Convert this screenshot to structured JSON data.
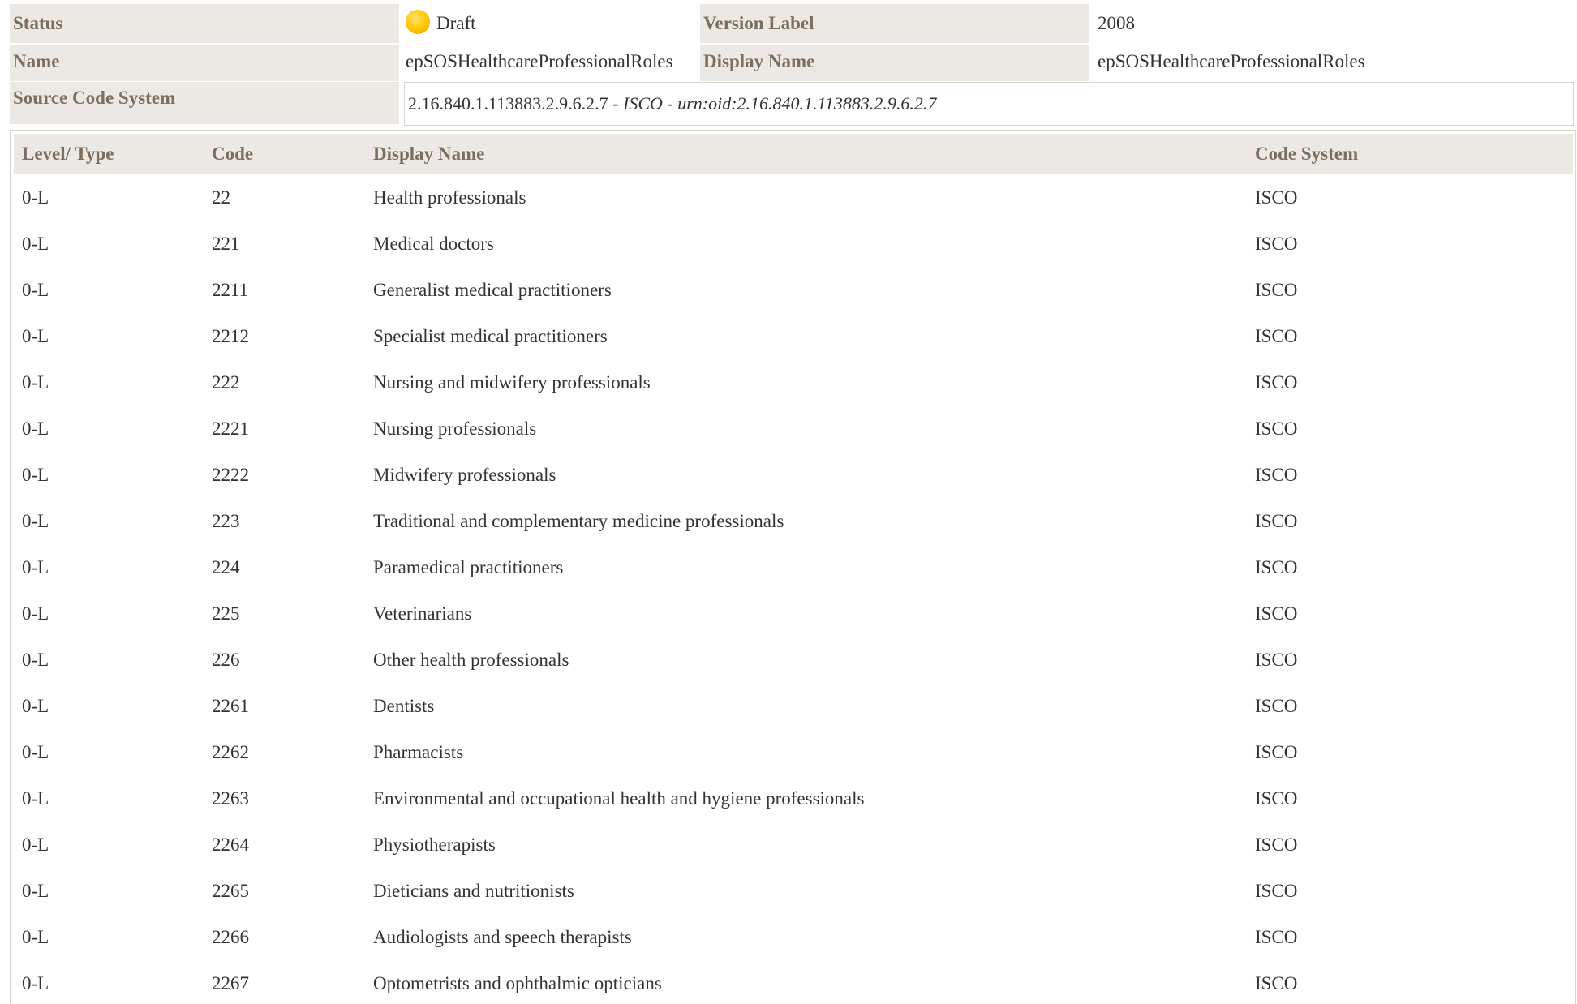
{
  "meta": {
    "status_label": "Status",
    "status_value": "Draft",
    "status_color": "#ffc400",
    "version_label": "Version Label",
    "version_value": "2008",
    "name_label": "Name",
    "name_value": "epSOSHealthcareProfessionalRoles",
    "display_name_label": "Display Name",
    "display_name_value": "epSOSHealthcareProfessionalRoles",
    "source_label": "Source Code System",
    "source_oid": "2.16.840.1.113883.2.9.6.2.7",
    "source_sep1": " - ",
    "source_name": "ISCO",
    "source_sep2": " - ",
    "source_urn": "urn:oid:2.16.840.1.113883.2.9.6.2.7"
  },
  "table": {
    "headers": [
      "Level/ Type",
      "Code",
      "Display Name",
      "Code System"
    ],
    "rows": [
      [
        "0-L",
        "22",
        "Health professionals",
        "ISCO"
      ],
      [
        "0-L",
        "221",
        "Medical doctors",
        "ISCO"
      ],
      [
        "0-L",
        "2211",
        "Generalist medical practitioners",
        "ISCO"
      ],
      [
        "0-L",
        "2212",
        "Specialist medical practitioners",
        "ISCO"
      ],
      [
        "0-L",
        "222",
        "Nursing and midwifery professionals",
        "ISCO"
      ],
      [
        "0-L",
        "2221",
        "Nursing professionals",
        "ISCO"
      ],
      [
        "0-L",
        "2222",
        "Midwifery professionals",
        "ISCO"
      ],
      [
        "0-L",
        "223",
        "Traditional and complementary medicine professionals",
        "ISCO"
      ],
      [
        "0-L",
        "224",
        "Paramedical practitioners",
        "ISCO"
      ],
      [
        "0-L",
        "225",
        "Veterinarians",
        "ISCO"
      ],
      [
        "0-L",
        "226",
        "Other health professionals",
        "ISCO"
      ],
      [
        "0-L",
        "2261",
        "Dentists",
        "ISCO"
      ],
      [
        "0-L",
        "2262",
        "Pharmacists",
        "ISCO"
      ],
      [
        "0-L",
        "2263",
        "Environmental and occupational health and hygiene professionals",
        "ISCO"
      ],
      [
        "0-L",
        "2264",
        "Physiotherapists",
        "ISCO"
      ],
      [
        "0-L",
        "2265",
        "Dieticians and nutritionists",
        "ISCO"
      ],
      [
        "0-L",
        "2266",
        "Audiologists and speech therapists",
        "ISCO"
      ],
      [
        "0-L",
        "2267",
        "Optometrists and ophthalmic opticians",
        "ISCO"
      ]
    ]
  }
}
